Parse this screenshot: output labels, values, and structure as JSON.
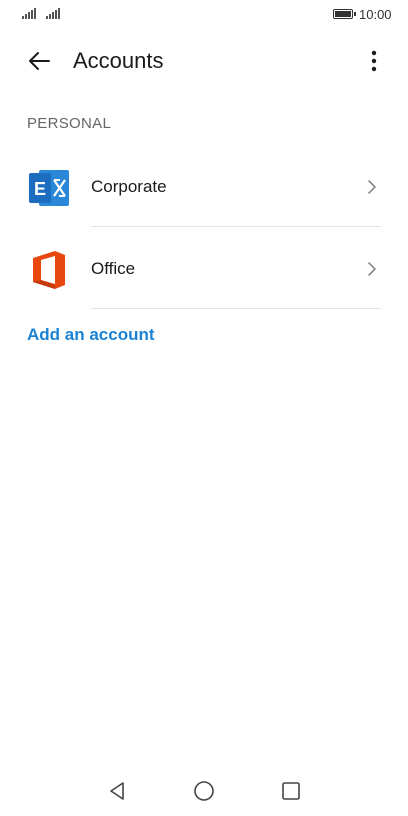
{
  "status_bar": {
    "time": "10:00",
    "icons": [
      "signal-icon",
      "signal-icon",
      "battery-icon"
    ]
  },
  "app_bar": {
    "title": "Accounts",
    "back_icon": "arrow-left-icon",
    "menu_icon": "more-vertical-icon"
  },
  "section": {
    "header": "PERSONAL"
  },
  "accounts": [
    {
      "label": "Corporate",
      "icon": "exchange-icon"
    },
    {
      "label": "Office",
      "icon": "office-icon"
    }
  ],
  "add_account": {
    "label": "Add an account"
  },
  "nav_bar": {
    "icons": [
      "nav-back-icon",
      "nav-home-icon",
      "nav-recent-icon"
    ]
  },
  "colors": {
    "accent": "#1a83d6",
    "exchange_blue": "#1c6cbf",
    "office_orange": "#e8480f"
  }
}
